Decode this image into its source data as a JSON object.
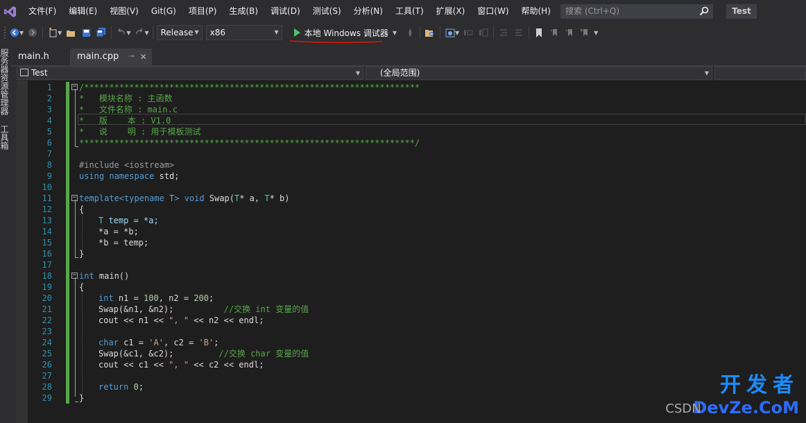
{
  "menu": [
    "文件(F)",
    "编辑(E)",
    "视图(V)",
    "Git(G)",
    "项目(P)",
    "生成(B)",
    "调试(D)",
    "测试(S)",
    "分析(N)",
    "工具(T)",
    "扩展(X)",
    "窗口(W)",
    "帮助(H)"
  ],
  "search": {
    "placeholder": "搜索 (Ctrl+Q)"
  },
  "solution_name": "Test",
  "toolbar": {
    "configuration": "Release",
    "platform": "x86",
    "run_label": "本地 Windows 调试器"
  },
  "left_strip": {
    "server_explorer": "服务器资源管理器",
    "toolbox": "工具箱"
  },
  "tabs": [
    {
      "label": "main.h"
    },
    {
      "label": "main.cpp"
    }
  ],
  "navbar": {
    "project": "Test",
    "scope": "(全局范围)"
  },
  "line_numbers": [
    "1",
    "2",
    "3",
    "4",
    "5",
    "6",
    "7",
    "8",
    "9",
    "10",
    "11",
    "12",
    "13",
    "14",
    "15",
    "16",
    "17",
    "18",
    "19",
    "20",
    "21",
    "22",
    "23",
    "24",
    "25",
    "26",
    "27",
    "28",
    "29"
  ],
  "code": {
    "l1": "/*******************************************************************",
    "l2": "*   模块名称 : 主函数",
    "l3": "*   文件名称 : main.c",
    "l4": "*   版    本 : V1.0",
    "l5": "*   说    明 : 用于模板测试",
    "l6": "*******************************************************************/",
    "l8": "#include <iostream>",
    "l9_kw": "using namespace",
    "l9_rest": " std;",
    "l11_kw1": "template",
    "l11_a": "<",
    "l11_kw2": "typename",
    "l11_t": " T",
    "l11_b": "> ",
    "l11_kw3": "void",
    "l11_c": " Swap(",
    "l11_t2": "T",
    "l11_d": "* a, ",
    "l11_t3": "T",
    "l11_e": "* b)",
    "l12": "{",
    "l13_t": "T",
    "l13_rest": " temp = *a;",
    "l14": "*a = *b;",
    "l15": "*b = temp;",
    "l16": "}",
    "l18_kw": "int",
    "l18_rest": " main()",
    "l19": "{",
    "l20_kw": "int",
    "l20_a": " n1 = ",
    "l20_n1": "100",
    "l20_b": ", n2 = ",
    "l20_n2": "200",
    "l20_c": ";",
    "l21_code": "Swap(&n1, &n2);          ",
    "l21_cm": "//交换 int 变量的值",
    "l22_a": "cout << n1 << ",
    "l22_s": "\", \"",
    "l22_b": " << n2 << endl;",
    "l24_kw": "char",
    "l24_a": " c1 = ",
    "l24_s1": "'A'",
    "l24_b": ", c2 = ",
    "l24_s2": "'B'",
    "l24_c": ";",
    "l25_code": "Swap(&c1, &c2);         ",
    "l25_cm": "//交换 char 变量的值",
    "l26_a": "cout << c1 << ",
    "l26_s": "\", \"",
    "l26_b": " << c2 << endl;",
    "l28_kw": "return",
    "l28_a": " ",
    "l28_n": "0",
    "l28_b": ";",
    "l29": "}"
  },
  "watermark": {
    "cn": "开发者",
    "en": "DevZe.CoM",
    "csdn": "CSDN"
  },
  "colors": {
    "accent_green": "#57a64a",
    "keyword": "#569cd6",
    "run_green": "#4ec36a",
    "underline_red": "#e51400"
  }
}
